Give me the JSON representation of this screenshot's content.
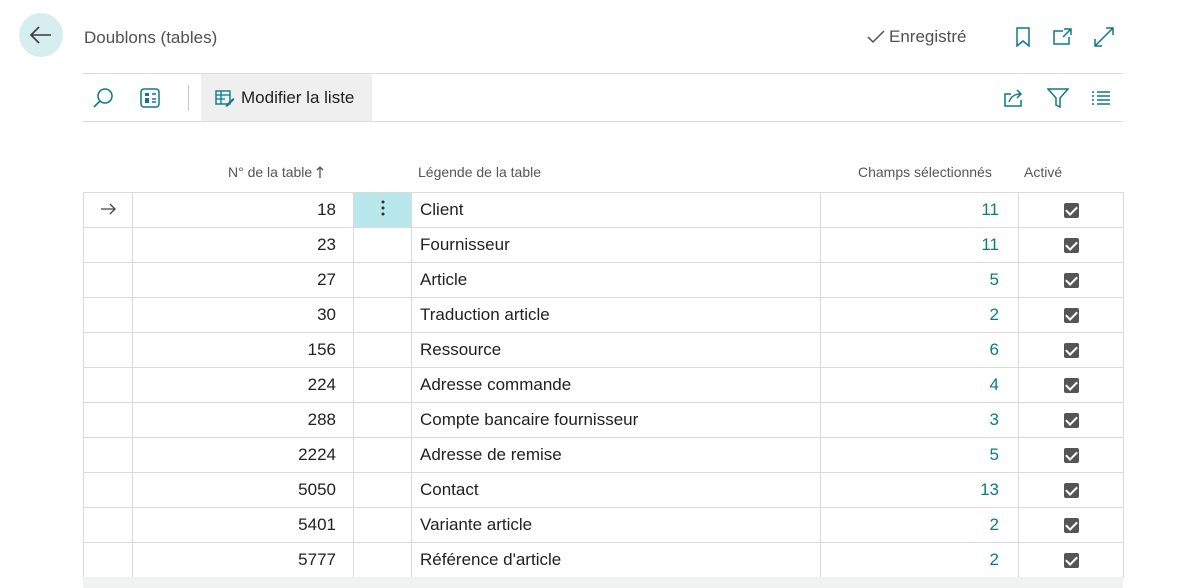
{
  "header": {
    "title": "Doublons (tables)",
    "saved_label": "Enregistré"
  },
  "toolbar": {
    "edit_list_label": "Modifier la liste"
  },
  "columns": {
    "table_no": "N° de la table",
    "caption": "Légende de la table",
    "selected_fields": "Champs sélectionnés",
    "active": "Activé"
  },
  "rows": [
    {
      "no": "18",
      "caption": "Client",
      "fields": "11",
      "active": true
    },
    {
      "no": "23",
      "caption": "Fournisseur",
      "fields": "11",
      "active": true
    },
    {
      "no": "27",
      "caption": "Article",
      "fields": "5",
      "active": true
    },
    {
      "no": "30",
      "caption": "Traduction article",
      "fields": "2",
      "active": true
    },
    {
      "no": "156",
      "caption": "Ressource",
      "fields": "6",
      "active": true
    },
    {
      "no": "224",
      "caption": "Adresse commande",
      "fields": "4",
      "active": true
    },
    {
      "no": "288",
      "caption": "Compte bancaire fournisseur",
      "fields": "3",
      "active": true
    },
    {
      "no": "2224",
      "caption": "Adresse de remise",
      "fields": "5",
      "active": true
    },
    {
      "no": "5050",
      "caption": "Contact",
      "fields": "13",
      "active": true
    },
    {
      "no": "5401",
      "caption": "Variante article",
      "fields": "2",
      "active": true
    },
    {
      "no": "5777",
      "caption": "Référence d'article",
      "fields": "2",
      "active": true
    }
  ],
  "colors": {
    "accent": "#0b7a86",
    "back_button_bg": "#d7eef0",
    "selected_cell_bg": "#b8e8ec"
  }
}
